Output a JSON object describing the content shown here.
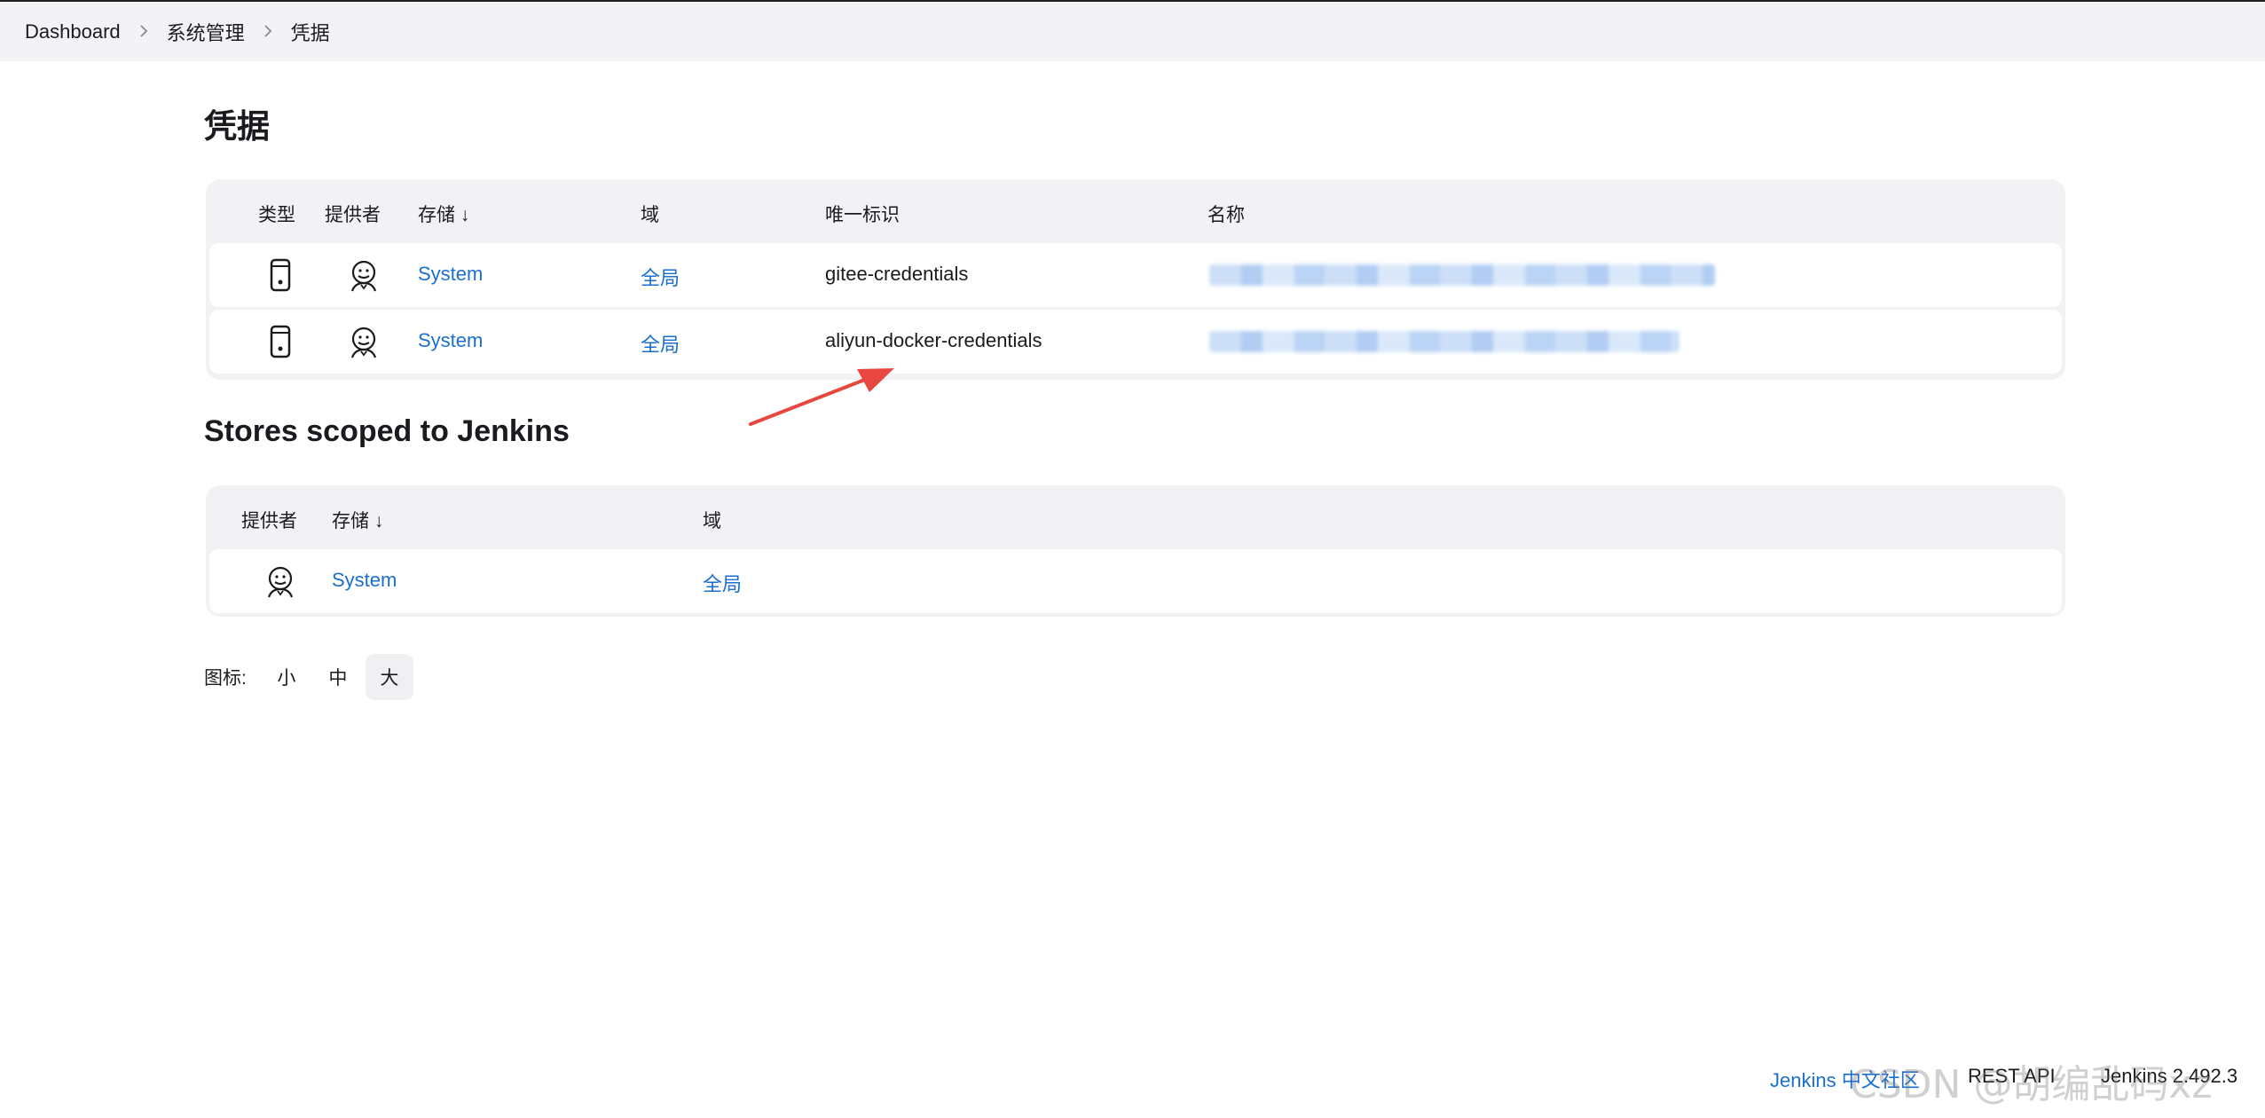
{
  "breadcrumb": {
    "items": [
      "Dashboard",
      "系统管理",
      "凭据"
    ],
    "separator": ">"
  },
  "page": {
    "title": "凭据",
    "stores_title": "Stores scoped to Jenkins"
  },
  "credentials_table": {
    "headers": {
      "type": "类型",
      "provider": "提供者",
      "store": "存储 ↓",
      "domain": "域",
      "id": "唯一标识",
      "name": "名称"
    },
    "rows": [
      {
        "type_icon": "mobile-device-icon",
        "provider_icon": "jenkins-butler-icon",
        "store": "System",
        "domain": "全局",
        "id": "gitee-credentials"
      },
      {
        "type_icon": "mobile-device-icon",
        "provider_icon": "jenkins-butler-icon",
        "store": "System",
        "domain": "全局",
        "id": "aliyun-docker-credentials"
      }
    ]
  },
  "stores_table": {
    "headers": {
      "provider": "提供者",
      "store": "存储 ↓",
      "domain": "域"
    },
    "rows": [
      {
        "provider_icon": "jenkins-butler-icon",
        "store": "System",
        "domain": "全局"
      }
    ]
  },
  "icon_size": {
    "label": "图标:",
    "options": [
      "小",
      "中",
      "大"
    ],
    "selected": "大"
  },
  "footer": {
    "community_link": "Jenkins 中文社区",
    "rest_api": "REST API",
    "version": "Jenkins 2.492.3"
  },
  "watermark": "CSDN @胡编乱码xz",
  "colors": {
    "link": "#1a6fd1",
    "breadcrumb_bg": "#f3f3f5",
    "table_bg": "#f2f2f5",
    "annotation_arrow": "#e8473f"
  }
}
